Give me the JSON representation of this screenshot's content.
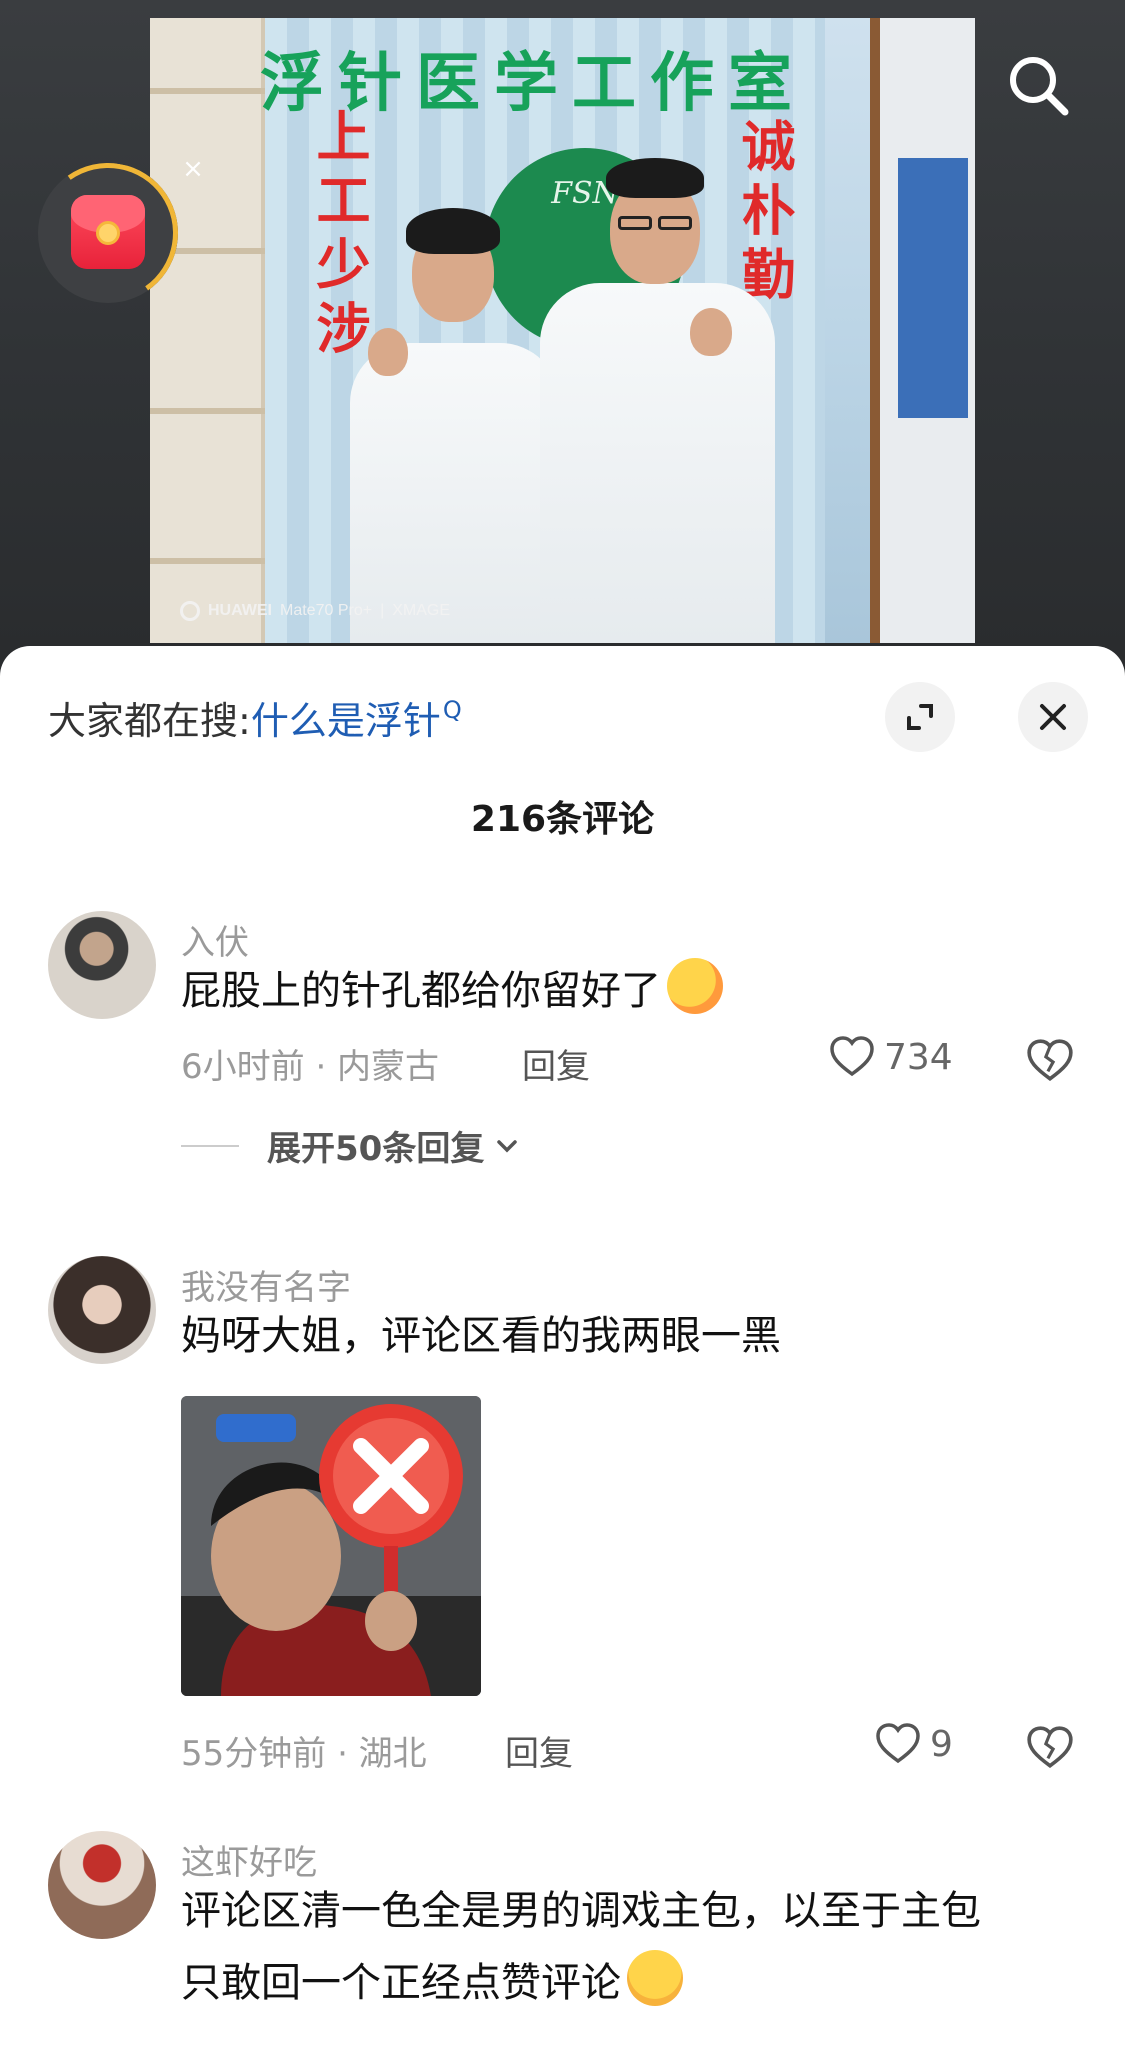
{
  "photo": {
    "banner": "浮针医学工作室",
    "left_couplet": "上工少涉",
    "right_couplet": "诚朴勤",
    "logo_text": "FSN",
    "watermark_brand": "HUAWEI",
    "watermark_model": "Mate70 Pro+",
    "watermark_sep": "|",
    "watermark_xmage": "XMAGE"
  },
  "redpacket": {
    "close": "×"
  },
  "sheet": {
    "search_prefix": "大家都在搜:",
    "search_keyword": "什么是浮针",
    "search_glyph": "Q",
    "comment_count": "216条评论"
  },
  "comments": [
    {
      "username": "入伏",
      "text": "屁股上的针孔都给你留好了",
      "time_loc": "6小时前 · 内蒙古",
      "reply": "回复",
      "likes": "734",
      "expand": "展开50条回复"
    },
    {
      "username": "我没有名字",
      "text": "妈呀大姐，评论区看的我两眼一黑",
      "time_loc": "55分钟前 · 湖北",
      "reply": "回复",
      "likes": "9"
    },
    {
      "username": "这虾好吃",
      "text_line1": "评论区清一色全是男的调戏主包，以至于主包",
      "text_line2": "只敢回一个正经点赞评论"
    }
  ],
  "colors": {
    "keyword_blue": "#1f5db3",
    "meta_gray": "#9a9a9a",
    "banner_green": "#17a25a",
    "couplet_red": "#e02a2a"
  }
}
